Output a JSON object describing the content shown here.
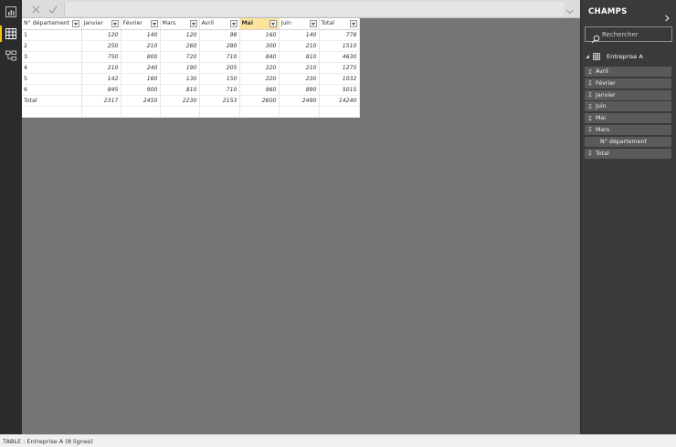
{
  "nav": {
    "items": [
      {
        "name": "report-view-button",
        "icon": "bar-chart-icon",
        "active": false
      },
      {
        "name": "data-view-button",
        "icon": "table-icon",
        "active": true
      },
      {
        "name": "model-view-button",
        "icon": "relationship-icon",
        "active": false
      }
    ]
  },
  "formula_bar": {
    "cancel_icon": "close-icon",
    "commit_icon": "check-icon",
    "value": ""
  },
  "grid": {
    "headers": [
      "N° département",
      "Janvier",
      "Février",
      "Mars",
      "Avril",
      "Mai",
      "Juin",
      "Total"
    ],
    "selected_column": "Mai",
    "rows": [
      [
        "1",
        "120",
        "140",
        "120",
        "98",
        "160",
        "140",
        "778"
      ],
      [
        "2",
        "250",
        "210",
        "260",
        "280",
        "300",
        "210",
        "1510"
      ],
      [
        "3",
        "750",
        "800",
        "720",
        "710",
        "840",
        "810",
        "4630"
      ],
      [
        "4",
        "210",
        "240",
        "190",
        "205",
        "220",
        "210",
        "1275"
      ],
      [
        "5",
        "142",
        "160",
        "130",
        "150",
        "220",
        "230",
        "1032"
      ],
      [
        "6",
        "845",
        "900",
        "810",
        "710",
        "860",
        "890",
        "5015"
      ],
      [
        "Total",
        "2317",
        "2450",
        "2230",
        "2153",
        "2600",
        "2490",
        "14240"
      ],
      [
        "",
        "",
        "",
        "",
        "",
        "",
        "",
        ""
      ]
    ]
  },
  "fields_pane": {
    "title": "CHAMPS",
    "search_placeholder": "Rechercher",
    "table_name": "Entreprise A",
    "fields": [
      {
        "label": "Avril",
        "sigma": true
      },
      {
        "label": "Février",
        "sigma": true
      },
      {
        "label": "Janvier",
        "sigma": true
      },
      {
        "label": "Juin",
        "sigma": true
      },
      {
        "label": "Mai",
        "sigma": true
      },
      {
        "label": "Mars",
        "sigma": true
      },
      {
        "label": "N° département",
        "sigma": false
      },
      {
        "label": "Total",
        "sigma": true
      }
    ],
    "sigma_glyph": "Σ"
  },
  "status_bar": {
    "text": "TABLE : Entreprise A (8 lignes)"
  },
  "colors": {
    "accent": "#f2c80f",
    "selected_header": "#fbe39a",
    "canvas": "#757575",
    "pane": "#3a3a3a"
  }
}
